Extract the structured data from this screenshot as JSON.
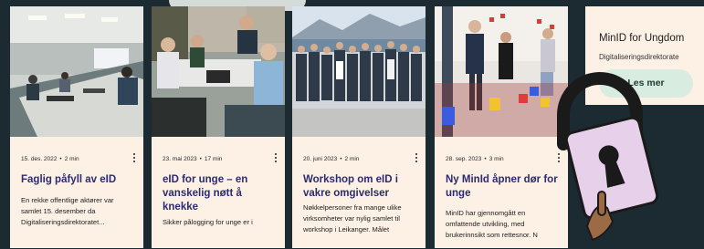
{
  "cards": [
    {
      "date": "15. des. 2022",
      "read_time": "2 min",
      "title": "Faglig påfyll av eID",
      "excerpt": "En rekke offentlige aktører var samlet 15. desember da Digitaliseringsdirektoratet..."
    },
    {
      "date": "23. mai 2023",
      "read_time": "17 min",
      "title": "eID for unge – en vanskelig nøtt å knekke",
      "excerpt": "Sikker pålogging for unge er i"
    },
    {
      "date": "20. juni 2023",
      "read_time": "2 min",
      "title": "Workshop om eID i vakre omgivelser",
      "excerpt": "Nøkkelpersoner fra mange ulike virksomheter var nylig samlet til workshop i Leikanger. Målet"
    },
    {
      "date": "28. sep. 2023",
      "read_time": "3 min",
      "title": "Ny MinId åpner dør for unge",
      "excerpt": "MinID har gjennomgått en omfattende utvikling, med brukerinnsikt som rettesnor. N"
    }
  ],
  "promo": {
    "title": "MinID for Ungdom",
    "subtitle": "Digitaliseringsdirektorate",
    "button": "Les mer"
  },
  "colors": {
    "background": "#1c2a32",
    "card": "#fdf0e4",
    "title": "#2b2b73",
    "button": "#d8ecdf",
    "lock_body": "#e6d0ea"
  }
}
